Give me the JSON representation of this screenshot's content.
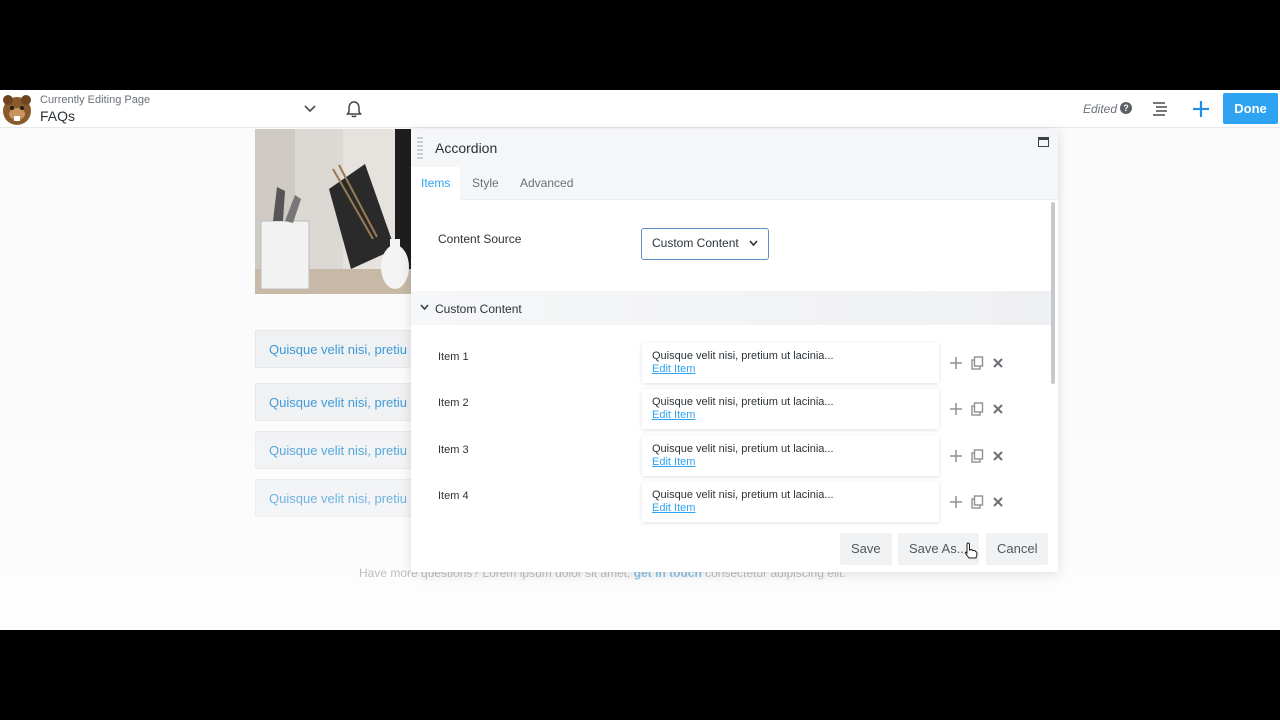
{
  "topbar": {
    "editing_label": "Currently Editing Page",
    "page_title": "FAQs",
    "status": "Edited",
    "help_glyph": "?",
    "done_label": "Done",
    "accent": "#2ea3f2"
  },
  "page": {
    "accordion_rows": [
      "Quisque velit nisi, pretiu",
      "Quisque velit nisi, pretiu",
      "Quisque velit nisi, pretiu",
      "Quisque velit nisi, pretiu"
    ],
    "bottom_text_before": "Have more questions? Lorem ipsum dolor sit amet, ",
    "bottom_link": "get in touch",
    "bottom_text_after": " consectetur adipiscing elit."
  },
  "panel": {
    "title": "Accordion",
    "tabs": [
      "Items",
      "Style",
      "Advanced"
    ],
    "content_source_label": "Content Source",
    "content_source_value": "Custom Content",
    "section_label": "Custom Content",
    "items": [
      {
        "label": "Item 1",
        "text": "Quisque velit nisi, pretium ut lacinia...",
        "edit": "Edit Item"
      },
      {
        "label": "Item 2",
        "text": "Quisque velit nisi, pretium ut lacinia...",
        "edit": "Edit Item"
      },
      {
        "label": "Item 3",
        "text": "Quisque velit nisi, pretium ut lacinia...",
        "edit": "Edit Item"
      },
      {
        "label": "Item 4",
        "text": "Quisque velit nisi, pretium ut lacinia...",
        "edit": "Edit Item"
      }
    ],
    "footer": {
      "save": "Save",
      "save_as": "Save As...",
      "cancel": "Cancel"
    }
  },
  "icons": {
    "chevron": "chevron-down-icon",
    "bell": "bell-icon",
    "outline": "outline-icon",
    "plus": "plus-icon",
    "maximize": "maximize-icon",
    "move": "move-icon",
    "copy": "copy-icon",
    "delete": "close-icon"
  }
}
